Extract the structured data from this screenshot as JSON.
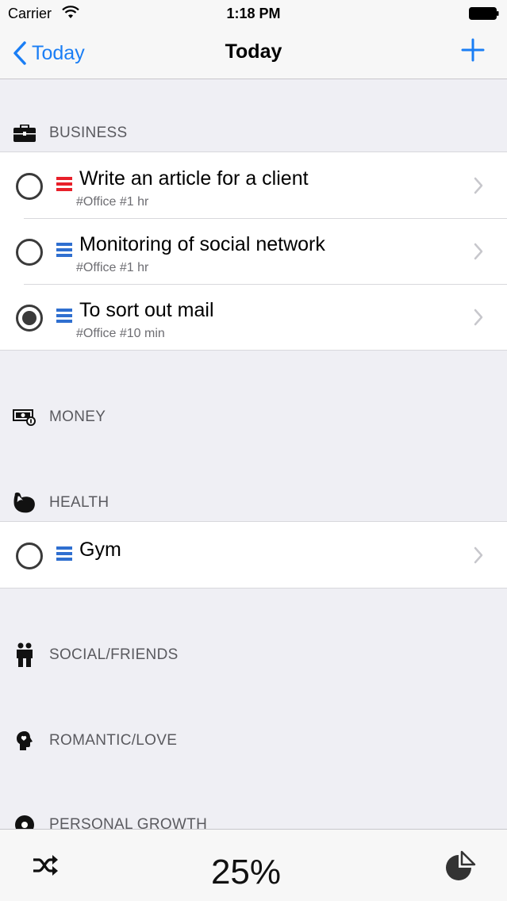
{
  "status_bar": {
    "carrier": "Carrier",
    "time": "1:18 PM"
  },
  "nav": {
    "back_label": "Today",
    "title": "Today"
  },
  "sections": {
    "business": {
      "label": "BUSINESS",
      "icon": "briefcase-icon"
    },
    "money": {
      "label": "MONEY",
      "icon": "money-icon"
    },
    "health": {
      "label": "HEALTH",
      "icon": "bicep-icon"
    },
    "social": {
      "label": "SOCIAL/FRIENDS",
      "icon": "people-icon"
    },
    "romantic": {
      "label": "ROMANTIC/LOVE",
      "icon": "heart-head-icon"
    },
    "growth": {
      "label": "PERSONAL GROWTH",
      "icon": "gear-head-icon"
    }
  },
  "business_tasks": [
    {
      "title": "Write an article for a client",
      "tags": "#Office #1 hr",
      "priority": "high",
      "done": false
    },
    {
      "title": "Monitoring of social network",
      "tags": "#Office #1 hr",
      "priority": "normal",
      "done": false
    },
    {
      "title": "To sort out mail",
      "tags": "#Office #10 min",
      "priority": "normal",
      "done": true
    }
  ],
  "health_tasks": [
    {
      "title": "Gym",
      "tags": "",
      "priority": "normal",
      "done": false
    }
  ],
  "footer": {
    "progress": "25%"
  },
  "colors": {
    "accent": "#1a7ef5",
    "priority_high": "#e8202a",
    "priority_normal": "#2f6fd0"
  }
}
